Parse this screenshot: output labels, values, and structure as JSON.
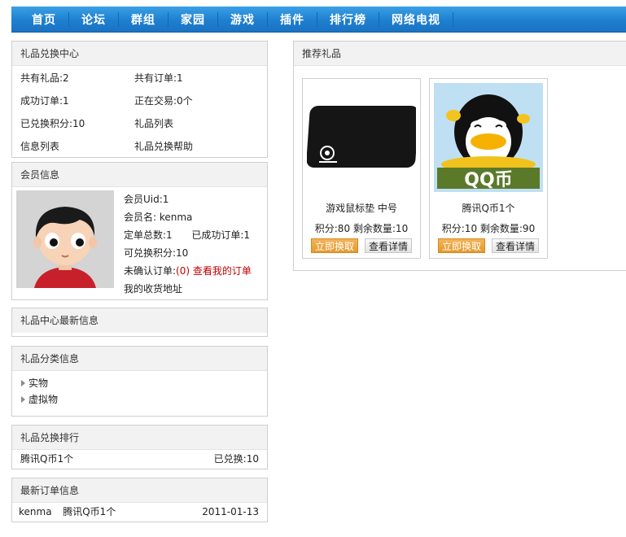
{
  "nav": {
    "items": [
      "首页",
      "论坛",
      "群组",
      "家园",
      "游戏",
      "插件",
      "排行榜",
      "网络电视"
    ]
  },
  "gift_center": {
    "title": "礼品兑换中心",
    "total_gifts": "共有礼品:2",
    "total_orders": "共有订单:1",
    "success_orders": "成功订单:1",
    "trading": "正在交易:0个",
    "redeemed_points": "已兑换积分:10",
    "gift_list": "礼品列表",
    "info_list": "信息列表",
    "help": "礼品兑换帮助"
  },
  "member": {
    "title": "会员信息",
    "uid": "会员Uid:1",
    "name": "会员名: kenma",
    "orders_total": "定单总数:1",
    "orders_success": "已成功订单:1",
    "points": "可兑换积分:10",
    "unconfirmed_prefix": "未确认订单:",
    "unconfirmed_count": "(0)",
    "my_orders_link": "查看我的订单",
    "address_link": "我的收货地址"
  },
  "news": {
    "title": "礼品中心最新信息"
  },
  "categories": {
    "title": "礼品分类信息",
    "items": [
      "实物",
      "虚拟物"
    ]
  },
  "ranking": {
    "title": "礼品兑换排行",
    "rows": [
      {
        "name": "腾讯Q币1个",
        "value": "已兑换:10"
      }
    ]
  },
  "latest_orders": {
    "title": "最新订单信息",
    "rows": [
      {
        "user": "kenma",
        "item": "腾讯Q币1个",
        "date": "2011-01-13"
      }
    ]
  },
  "recommended": {
    "title": "推荐礼品",
    "gifts": [
      {
        "name": "游戏鼠标垫 中号",
        "meta": "积分:80 剩余数量:10",
        "exchange": "立即换取",
        "detail": "查看详情",
        "image": "mousepad-image"
      },
      {
        "name": "腾讯Q币1个",
        "meta": "积分:10 剩余数量:90",
        "exchange": "立即换取",
        "detail": "查看详情",
        "image": "qq-penguin-image"
      }
    ]
  },
  "colors": {
    "nav_blue": "#1f7fcf",
    "link_red": "#c00000",
    "button_orange": "#e49a2c"
  }
}
